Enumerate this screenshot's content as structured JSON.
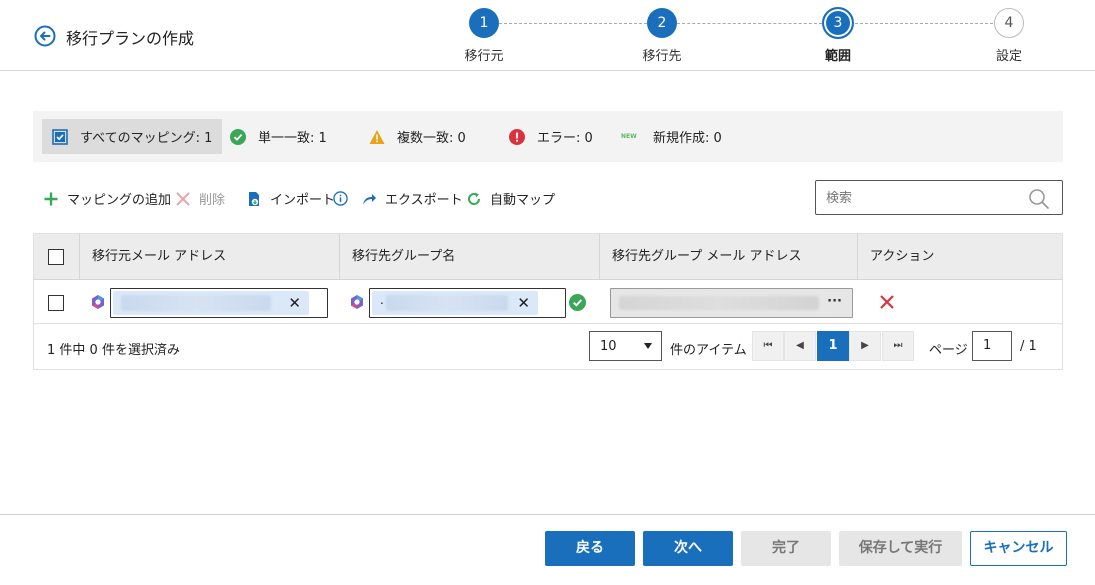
{
  "header": {
    "title": "移行プランの作成",
    "steps": [
      {
        "number": "1",
        "label": "移行元",
        "state": "completed"
      },
      {
        "number": "2",
        "label": "移行先",
        "state": "completed"
      },
      {
        "number": "3",
        "label": "範囲",
        "state": "current"
      },
      {
        "number": "4",
        "label": "設定",
        "state": "pending"
      }
    ]
  },
  "summary": {
    "all": "すべてのマッピング: 1",
    "single": "単一一致: 1",
    "multiple": "複数一致: 0",
    "error": "エラー: 0",
    "new_badge": "NEW",
    "new": "新規作成: 0"
  },
  "toolbar": {
    "add": "マッピングの追加",
    "delete": "削除",
    "import": "インポート",
    "export": "エクスポート",
    "automap": "自動マップ",
    "search_placeholder": "検索"
  },
  "table": {
    "columns": [
      "移行元メール アドレス",
      "移行先グループ名",
      "移行先グループ メール アドレス",
      "アクション"
    ],
    "rows": [
      {
        "source_email": "",
        "target_group": ".",
        "target_group_email": "",
        "more": "···"
      }
    ]
  },
  "pagination": {
    "selected_text": "1 件中 0 件を選択済み",
    "per_page": "10",
    "items_label": "件のアイテム",
    "current_page": "1",
    "page_label": "ページ",
    "page_input": "1",
    "total": "/ 1"
  },
  "buttons": {
    "back": "戻る",
    "next": "次へ",
    "finish": "完了",
    "save_run": "保存して実行",
    "cancel": "キャンセル"
  },
  "colors": {
    "primary": "#1a6fbd",
    "success": "#3aa757",
    "warning": "#e8a317",
    "error": "#d9333f",
    "new": "#5cb85c"
  }
}
